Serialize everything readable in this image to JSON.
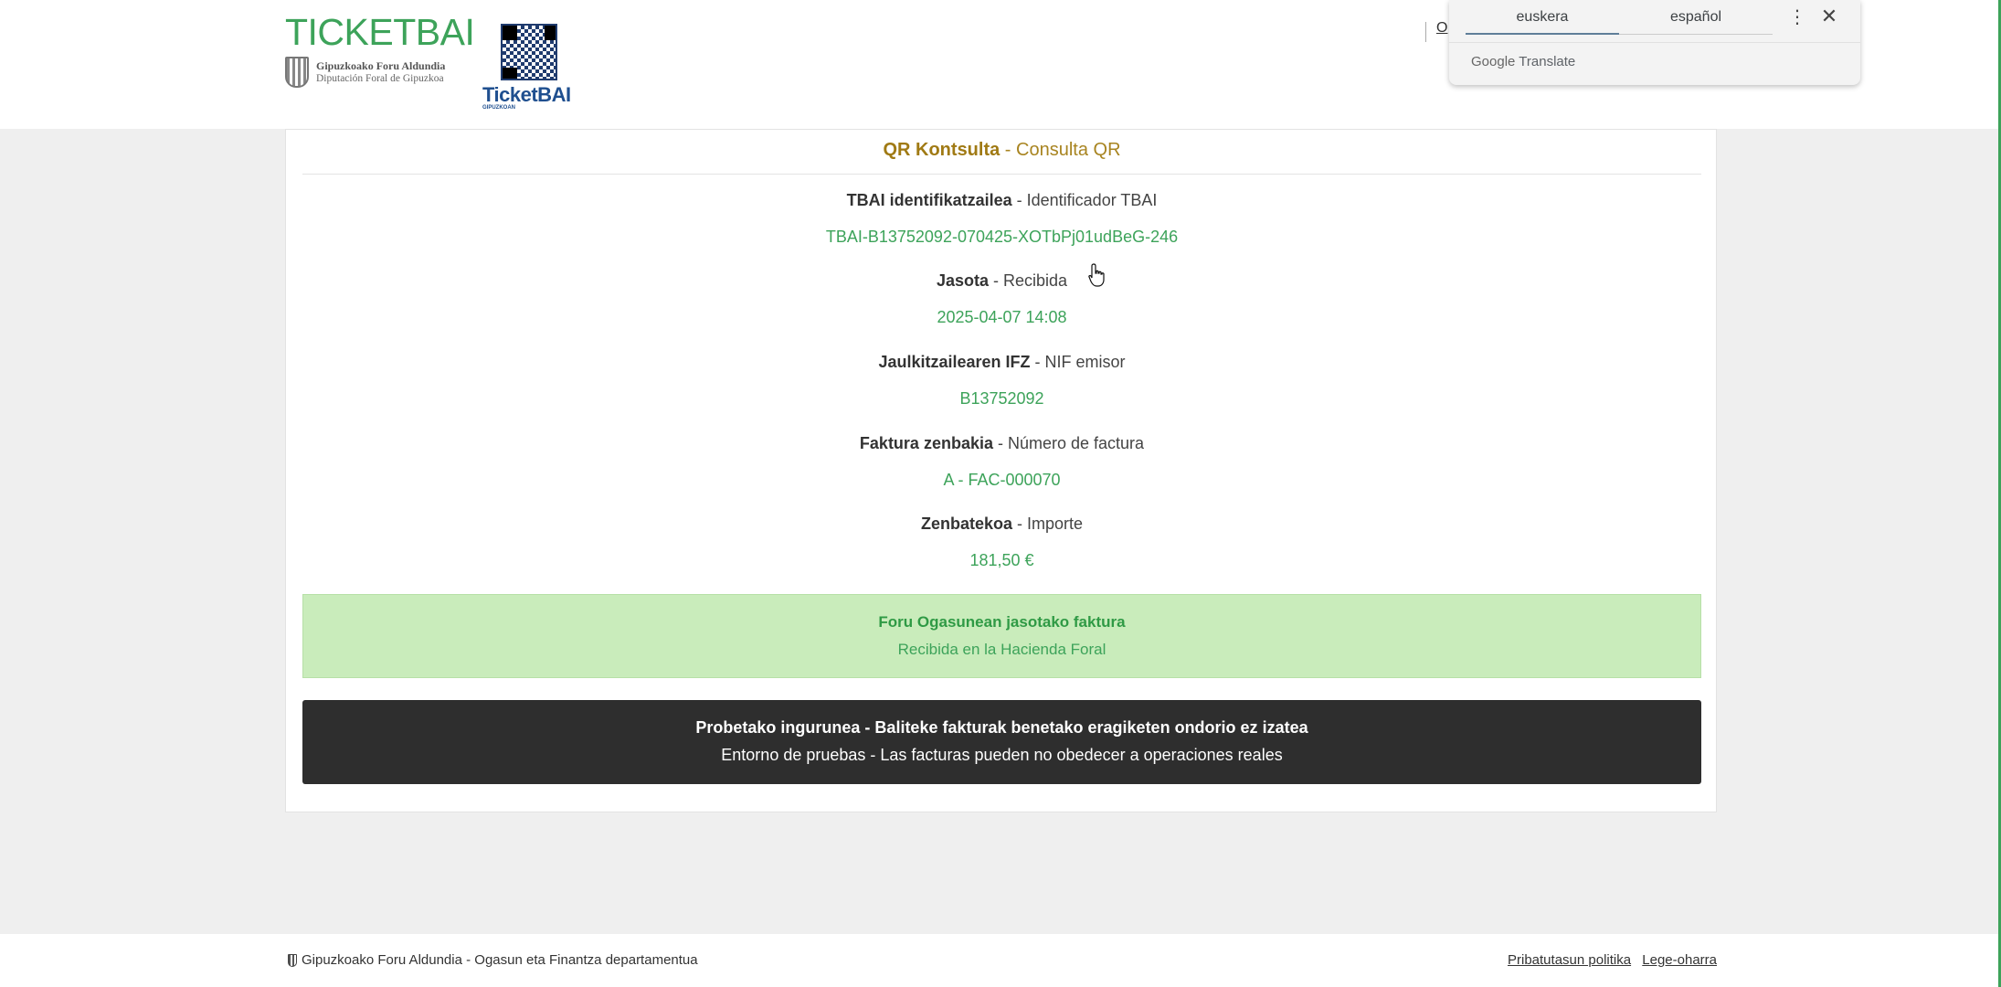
{
  "header": {
    "brand": "TICKETBAI",
    "org_line1": "Gipuzkoako Foru Aldundia",
    "org_line2": "Diputación Foral de Gipuzkoa",
    "qr_title": "TicketBAI",
    "qr_sub": "GIPUZKOAN",
    "peek_text": "O"
  },
  "translate_popup": {
    "tab_active": "euskera",
    "tab_inactive": "español",
    "more_icon": "⋮",
    "close_icon": "✕",
    "brand_google": "Google",
    "brand_translate": "Translate"
  },
  "card": {
    "title_bold": "QR Kontsulta",
    "title_rest": " - Consulta QR",
    "fields": [
      {
        "label_bold": "TBAI identifikatzailea",
        "label_rest": " - Identificador TBAI",
        "value": "TBAI-B13752092-070425-XOTbPj01udBeG-246"
      },
      {
        "label_bold": "Jasota",
        "label_rest": " - Recibida",
        "value": "2025-04-07 14:08"
      },
      {
        "label_bold": "Jaulkitzailearen IFZ",
        "label_rest": " - NIF emisor",
        "value": "B13752092"
      },
      {
        "label_bold": "Faktura zenbakia",
        "label_rest": " - Número de factura",
        "value": "A - FAC-000070"
      },
      {
        "label_bold": "Zenbatekoa",
        "label_rest": " - Importe",
        "value": "181,50 €"
      }
    ],
    "status_eu": "Foru Ogasunean jasotako faktura",
    "status_es": "Recibida en la Hacienda Foral",
    "warning_eu": "Probetako ingurunea - Baliteke fakturak benetako eragiketen ondorio ez izatea",
    "warning_es": "Entorno de pruebas - Las facturas pueden no obedecer a operaciones reales"
  },
  "footer": {
    "left_text": "Gipuzkoako Foru Aldundia - Ogasun eta Finantza departamentua",
    "link_privacy": "Pribatutasun politika",
    "link_legal": "Lege-oharra"
  },
  "colors": {
    "green": "#3da35a",
    "gold": "#a88420",
    "status_bg": "#c9ecbb",
    "warning_bg": "#2e2e2e"
  }
}
